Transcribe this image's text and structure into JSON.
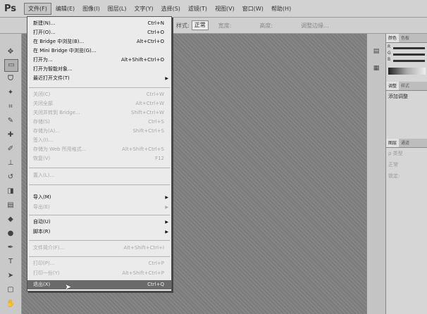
{
  "app": {
    "logo": "Ps"
  },
  "menubar": {
    "items": [
      {
        "label": "文件(F)"
      },
      {
        "label": "编辑(E)"
      },
      {
        "label": "图像(I)"
      },
      {
        "label": "图层(L)"
      },
      {
        "label": "文字(Y)"
      },
      {
        "label": "选择(S)"
      },
      {
        "label": "滤镜(T)"
      },
      {
        "label": "视图(V)"
      },
      {
        "label": "窗口(W)"
      },
      {
        "label": "帮助(H)"
      }
    ]
  },
  "options_bar": {
    "style_label": "样式:",
    "style_value": "正常",
    "width_label": "宽度:",
    "height_label": "高度:",
    "refine_label": "调整边缘..."
  },
  "file_menu": {
    "items": [
      {
        "label": "新建(N)...",
        "shortcut": "Ctrl+N",
        "enabled": true
      },
      {
        "label": "打开(O)...",
        "shortcut": "Ctrl+O",
        "enabled": true
      },
      {
        "label": "在 Bridge 中浏览(B)...",
        "shortcut": "Alt+Ctrl+O",
        "enabled": true
      },
      {
        "label": "在 Mini Bridge 中浏览(G)...",
        "shortcut": "",
        "enabled": true
      },
      {
        "label": "打开为...",
        "shortcut": "Alt+Shift+Ctrl+O",
        "enabled": true
      },
      {
        "label": "打开为智能对象...",
        "shortcut": "",
        "enabled": true
      },
      {
        "label": "最近打开文件(T)",
        "shortcut": "",
        "enabled": true,
        "submenu": true
      },
      {
        "label": "关闭(C)",
        "shortcut": "Ctrl+W",
        "enabled": false
      },
      {
        "label": "关闭全部",
        "shortcut": "Alt+Ctrl+W",
        "enabled": false
      },
      {
        "label": "关闭并转到 Bridge...",
        "shortcut": "Shift+Ctrl+W",
        "enabled": false
      },
      {
        "label": "存储(S)",
        "shortcut": "Ctrl+S",
        "enabled": false
      },
      {
        "label": "存储为(A)...",
        "shortcut": "Shift+Ctrl+S",
        "enabled": false
      },
      {
        "label": "签入(I)...",
        "shortcut": "",
        "enabled": false
      },
      {
        "label": "存储为 Web 所用格式...",
        "shortcut": "Alt+Shift+Ctrl+S",
        "enabled": false
      },
      {
        "label": "恢复(V)",
        "shortcut": "F12",
        "enabled": false
      },
      {
        "label": "置入(L)...",
        "shortcut": "",
        "enabled": false
      },
      {
        "label": "导入(M)",
        "shortcut": "",
        "enabled": true,
        "submenu": true
      },
      {
        "label": "导出(E)",
        "shortcut": "",
        "enabled": false,
        "submenu": true
      },
      {
        "label": "自动(U)",
        "shortcut": "",
        "enabled": true,
        "submenu": true
      },
      {
        "label": "脚本(R)",
        "shortcut": "",
        "enabled": true,
        "submenu": true
      },
      {
        "label": "文件简介(F)...",
        "shortcut": "Alt+Shift+Ctrl+I",
        "enabled": false
      },
      {
        "label": "打印(P)...",
        "shortcut": "Ctrl+P",
        "enabled": false
      },
      {
        "label": "打印一份(Y)",
        "shortcut": "Alt+Shift+Ctrl+P",
        "enabled": false
      },
      {
        "label": "退出(X)",
        "shortcut": "Ctrl+Q",
        "enabled": true,
        "highlighted": true
      }
    ]
  },
  "panels": {
    "color_tabs": [
      "颜色",
      "色板"
    ],
    "channels": [
      "R",
      "G",
      "B"
    ],
    "adjust_tabs": [
      "调整",
      "样式"
    ],
    "adjust_title": "添加调整",
    "layer_tabs": [
      "图层",
      "通道"
    ],
    "layer_kind": "ρ 类型",
    "layer_mode": "正常",
    "layer_lock": "锁定:"
  }
}
